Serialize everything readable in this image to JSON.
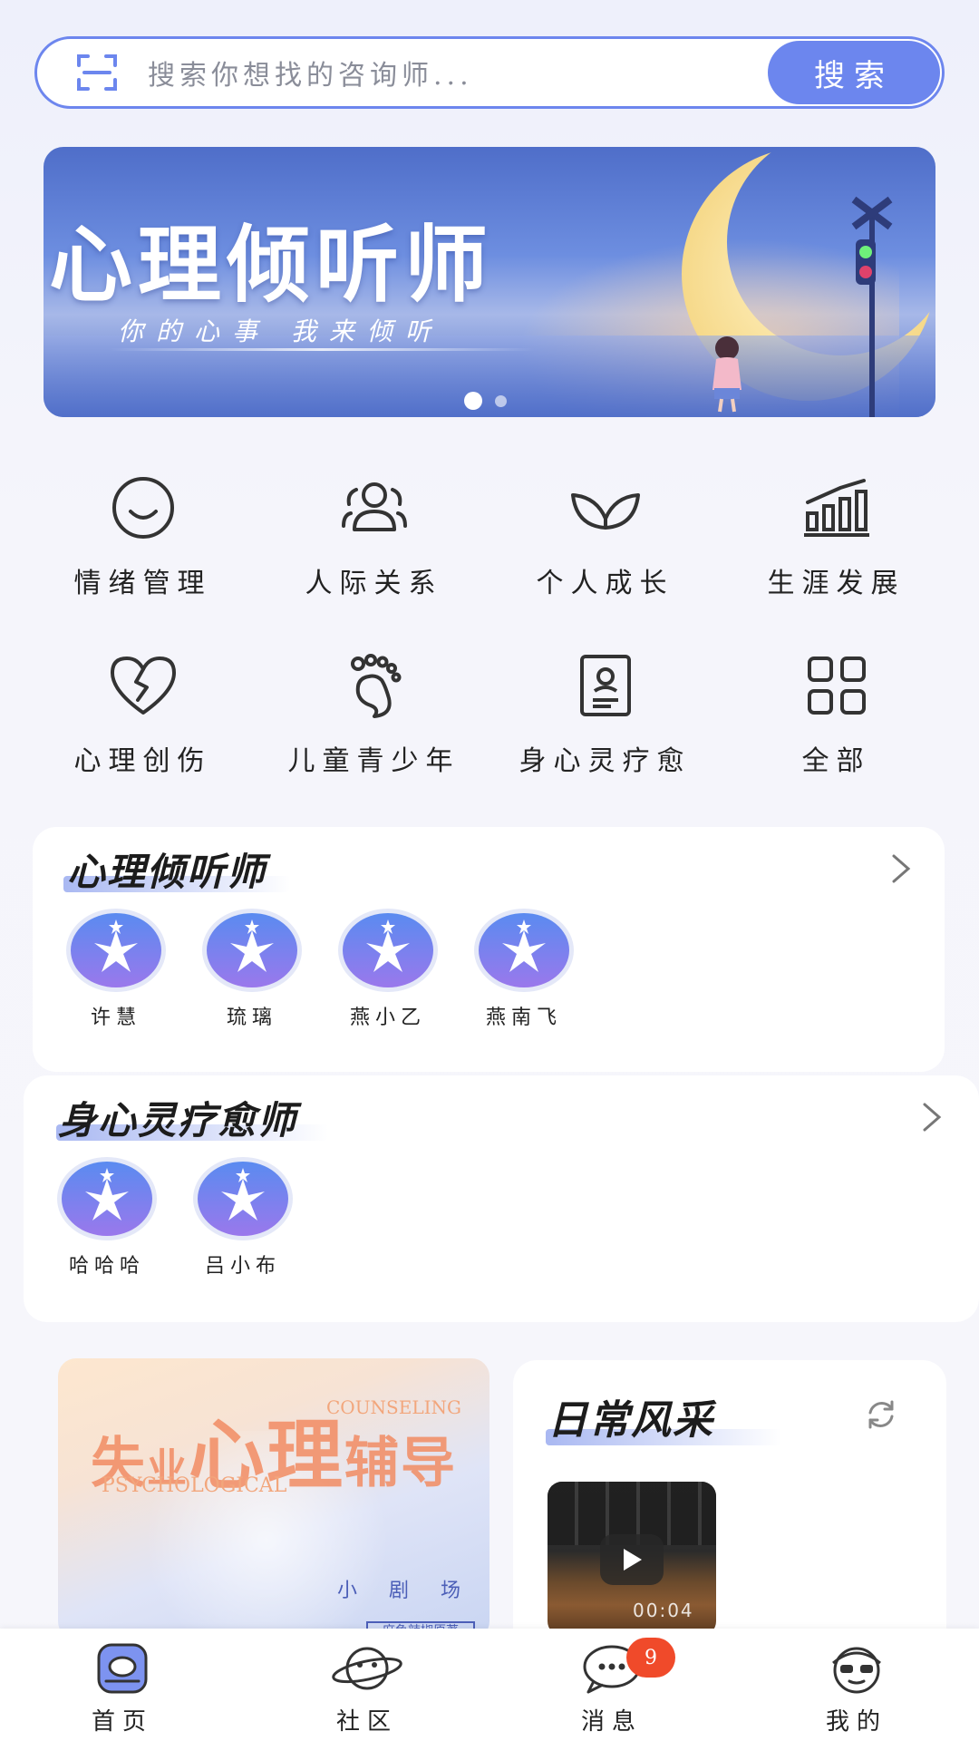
{
  "search": {
    "placeholder": "搜索你想找的咨询师...",
    "button_label": "搜索"
  },
  "banner": {
    "title": "心理倾听师",
    "subtitle": "你的心事 我来倾听",
    "slide_count": 2,
    "active_slide": 1
  },
  "categories": [
    {
      "label": "情绪管理",
      "icon": "smile-face-icon"
    },
    {
      "label": "人际关系",
      "icon": "people-group-icon"
    },
    {
      "label": "个人成长",
      "icon": "sprout-icon"
    },
    {
      "label": "生涯发展",
      "icon": "bar-chart-icon"
    },
    {
      "label": "心理创伤",
      "icon": "broken-heart-icon"
    },
    {
      "label": "儿童青少年",
      "icon": "footprint-icon"
    },
    {
      "label": "身心灵疗愈",
      "icon": "id-card-icon"
    },
    {
      "label": "全部",
      "icon": "grid-icon"
    }
  ],
  "listeners": {
    "title": "心理倾听师",
    "people": [
      "许慧",
      "琉璃",
      "燕小乙",
      "燕南飞"
    ]
  },
  "healers": {
    "title": "身心灵疗愈师",
    "people": [
      "哈哈哈",
      "吕小布"
    ]
  },
  "promo": {
    "title_part1": "失",
    "title_part2": "业",
    "title_part3": "心理",
    "title_part4": "辅导",
    "english_top": "COUNSELING",
    "english_bottom": "PSYCHOLOGICAL",
    "theater_label": "小 剧 场",
    "tag": "麻鱼辣椒原著"
  },
  "daily": {
    "title": "日常风采",
    "video_time": "00:04"
  },
  "nav": [
    {
      "label": "首页",
      "icon": "home-icon"
    },
    {
      "label": "社区",
      "icon": "planet-icon"
    },
    {
      "label": "消息",
      "icon": "chat-bubble-icon",
      "badge": "9"
    },
    {
      "label": "我的",
      "icon": "profile-icon"
    }
  ],
  "colors": {
    "accent": "#6c86ee",
    "badge": "#f04a2a",
    "avatar": "#7b88ef"
  }
}
